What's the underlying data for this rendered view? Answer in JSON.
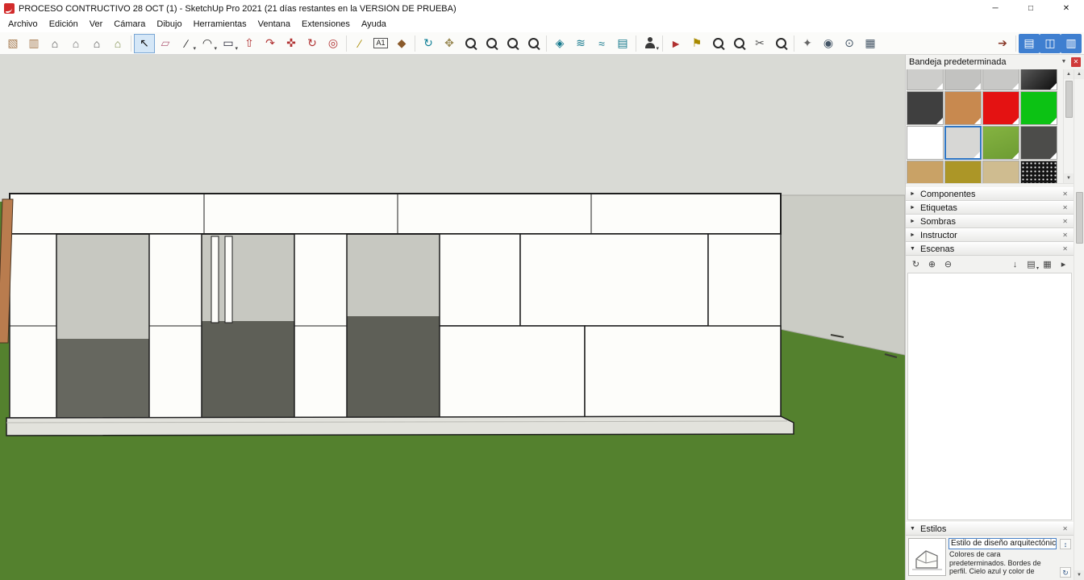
{
  "window": {
    "title": "PROCESO CONTRUCTIVO 28 OCT (1) - SketchUp Pro 2021 (21 días restantes en la VERSIÓN DE PRUEBA)",
    "controls": {
      "minimize": "─",
      "maximize": "□",
      "close": "✕"
    }
  },
  "menu": {
    "items": [
      {
        "name": "menu-archivo",
        "label": "Archivo"
      },
      {
        "name": "menu-edicion",
        "label": "Edición"
      },
      {
        "name": "menu-ver",
        "label": "Ver"
      },
      {
        "name": "menu-camara",
        "label": "Cámara"
      },
      {
        "name": "menu-dibujo",
        "label": "Dibujo"
      },
      {
        "name": "menu-herramientas",
        "label": "Herramientas"
      },
      {
        "name": "menu-ventana",
        "label": "Ventana"
      },
      {
        "name": "menu-extensiones",
        "label": "Extensiones"
      },
      {
        "name": "menu-ayuda",
        "label": "Ayuda"
      }
    ]
  },
  "toolbar": {
    "items": [
      {
        "name": "paste-box-icon",
        "glyph": "▧",
        "gs": "color:#a5794e",
        "inter": "true"
      },
      {
        "name": "copy-box-icon",
        "glyph": "▥",
        "gs": "color:#a5794e",
        "inter": "true"
      },
      {
        "name": "home-model-icon",
        "glyph": "⌂",
        "gs": "color:#4a4a4a",
        "inter": "true"
      },
      {
        "name": "home-stack-icon",
        "glyph": "⌂",
        "gs": "color:#6b6b6b",
        "inter": "true"
      },
      {
        "name": "home-alt-icon",
        "glyph": "⌂",
        "gs": "color:#4a4a4a",
        "inter": "true"
      },
      {
        "name": "home-plan-icon",
        "glyph": "⌂",
        "gs": "color:#7c8b49",
        "inter": "true"
      },
      {
        "name": "separator",
        "kind": "sep",
        "inter": "false"
      },
      {
        "name": "select-tool",
        "glyph": "↖",
        "gs": "color:#111",
        "sel": "true",
        "inter": "true"
      },
      {
        "name": "eraser-tool",
        "glyph": "▱",
        "gs": "color:#b2607a",
        "inter": "true"
      },
      {
        "name": "line-tool",
        "glyph": "∕",
        "gs": "color:#222",
        "dd": "▾",
        "inter": "true"
      },
      {
        "name": "arc-tool",
        "glyph": "◠",
        "gs": "color:#222",
        "dd": "▾",
        "inter": "true"
      },
      {
        "name": "rectangle-tool",
        "glyph": "▭",
        "gs": "color:#223",
        "dd": "▾",
        "inter": "true"
      },
      {
        "name": "pushpull-tool",
        "glyph": "⇧",
        "gs": "color:#b03030",
        "inter": "true"
      },
      {
        "name": "followme-tool",
        "glyph": "↷",
        "gs": "color:#b03030",
        "inter": "true"
      },
      {
        "name": "move-tool",
        "glyph": "✜",
        "gs": "color:#b03030",
        "inter": "true"
      },
      {
        "name": "rotate-tool",
        "glyph": "↻",
        "gs": "color:#b03030",
        "inter": "true"
      },
      {
        "name": "offset-tool",
        "glyph": "◎",
        "gs": "color:#b03030",
        "inter": "true"
      },
      {
        "name": "separator",
        "kind": "sep",
        "inter": "false"
      },
      {
        "name": "tape-measure-tool",
        "glyph": "∕",
        "gs": "color:#a88a00",
        "inter": "true"
      },
      {
        "name": "text-tool",
        "glyph": "A1",
        "kind": "text",
        "gs": "color:#222",
        "inter": "true"
      },
      {
        "name": "paint-bucket-tool",
        "glyph": "◆",
        "gs": "color:#8a5a2a",
        "inter": "true"
      },
      {
        "name": "separator",
        "kind": "sep",
        "inter": "false"
      },
      {
        "name": "orbit-tool",
        "glyph": "↻",
        "gs": "color:#0e7f96",
        "inter": "true"
      },
      {
        "name": "pan-tool",
        "glyph": "✥",
        "gs": "color:#9a8a55",
        "inter": "true"
      },
      {
        "name": "zoom-tool",
        "kind": "mag",
        "inter": "true"
      },
      {
        "name": "zoom-window-tool",
        "kind": "mag",
        "inter": "true"
      },
      {
        "name": "zoom-extents-tool",
        "kind": "mag",
        "inter": "true"
      },
      {
        "name": "previous-view-tool",
        "kind": "mag",
        "inter": "true"
      },
      {
        "name": "separator",
        "kind": "sep",
        "inter": "false"
      },
      {
        "name": "section-plane-tool",
        "glyph": "◈",
        "gs": "color:#14788c",
        "inter": "true"
      },
      {
        "name": "section-display-toggle",
        "glyph": "≋",
        "gs": "color:#14788c",
        "inter": "true"
      },
      {
        "name": "section-cuts-toggle",
        "glyph": "≈",
        "gs": "color:#14788c",
        "inter": "true"
      },
      {
        "name": "section-fill-toggle",
        "glyph": "▤",
        "gs": "color:#14788c",
        "inter": "true"
      },
      {
        "name": "separator",
        "kind": "sep",
        "inter": "false"
      },
      {
        "name": "camera-person-tool",
        "kind": "person",
        "dd": "▾",
        "inter": "true"
      },
      {
        "name": "separator",
        "kind": "sep",
        "inter": "false"
      },
      {
        "name": "walk-tool",
        "glyph": "►",
        "gs": "color:#b03030",
        "inter": "true"
      },
      {
        "name": "position-camera-tool",
        "glyph": "⚑",
        "gs": "color:#a88a00",
        "inter": "true"
      },
      {
        "name": "zoom-photo-tool",
        "kind": "mag",
        "inter": "true"
      },
      {
        "name": "zoom-selection-tool",
        "kind": "mag",
        "inter": "true"
      },
      {
        "name": "scissors-tool",
        "glyph": "✂",
        "gs": "color:#555",
        "inter": "true"
      },
      {
        "name": "inspect-tool",
        "kind": "mag",
        "inter": "true"
      },
      {
        "name": "separator",
        "kind": "sep",
        "inter": "false"
      },
      {
        "name": "spray-tool-icon",
        "glyph": "✦",
        "gs": "color:#666",
        "inter": "true"
      },
      {
        "name": "look-around-tool",
        "glyph": "◉",
        "gs": "color:#456",
        "inter": "true"
      },
      {
        "name": "binoculars-icon",
        "glyph": "⊙",
        "gs": "color:#456",
        "inter": "true"
      },
      {
        "name": "animation-icon",
        "glyph": "▦",
        "gs": "color:#456",
        "inter": "true"
      },
      {
        "name": "spacer",
        "kind": "spacer",
        "inter": "false"
      },
      {
        "name": "send-to-layout-icon",
        "glyph": "➔",
        "gs": "color:#8a3a2a",
        "inter": "true"
      },
      {
        "name": "separator",
        "kind": "sep",
        "inter": "false"
      },
      {
        "name": "panel-toggle-1-icon",
        "glyph": "▤",
        "kind": "active",
        "inter": "true"
      },
      {
        "name": "panel-toggle-2-icon",
        "glyph": "◫",
        "kind": "active",
        "inter": "true"
      },
      {
        "name": "panel-toggle-3-icon",
        "glyph": "▥",
        "kind": "active",
        "inter": "true"
      }
    ]
  },
  "viewport": {
    "colors": {
      "sky": "#d9dad5",
      "ground": "#54812e",
      "side_plane": "#cbccc5",
      "wall": "#fdfdfa",
      "interior_upper": "#c7c8c1",
      "interior_lower": "#66675f",
      "interior_dark": "#5e5f57",
      "slab": "#e2e2dc",
      "column": "#b97c4e",
      "edge": "#1e1e1e"
    }
  },
  "tray": {
    "title": "Bandeja predeterminada",
    "pin": "▼",
    "close": "✕",
    "scroll_up": "▲",
    "scroll_down": "▼",
    "materials": {
      "swatches": [
        {
          "name": "material-light-gray-1",
          "style": "background:#cdcdcb",
          "inter": "true"
        },
        {
          "name": "material-gray-2",
          "style": "background:#c2c2c0",
          "inter": "true"
        },
        {
          "name": "material-gray-3",
          "style": "background:#c8c8c6",
          "inter": "true"
        },
        {
          "name": "material-black-gradient",
          "style": "background:linear-gradient(135deg,#6a6a6a,#0d0d0d)",
          "inter": "true"
        },
        {
          "name": "material-charcoal",
          "style": "background:#3f3f3f",
          "inter": "true"
        },
        {
          "name": "material-orange-texture",
          "style": "background:#c8894f",
          "inter": "true"
        },
        {
          "name": "material-red",
          "style": "background:#e41212",
          "inter": "true"
        },
        {
          "name": "material-green",
          "style": "background:#0cc214",
          "inter": "true"
        },
        {
          "name": "material-white",
          "style": "background:#ffffff",
          "inter": "true"
        },
        {
          "name": "material-default-light-gray",
          "style": "background:#d7d7d5",
          "selected": "true",
          "inter": "true"
        },
        {
          "name": "material-grass",
          "style": "background:linear-gradient(160deg,#85b341,#6d9c33)",
          "inter": "true"
        },
        {
          "name": "material-asphalt",
          "style": "background:#4c4c4a",
          "inter": "true"
        },
        {
          "name": "material-wood-tan",
          "style": "background:#c9a266",
          "inter": "true"
        },
        {
          "name": "material-olive",
          "style": "background:#ac9627",
          "inter": "true"
        },
        {
          "name": "material-beige",
          "style": "background:#cfbc90",
          "inter": "true"
        },
        {
          "name": "material-black-dots",
          "style": "background:radial-gradient(#f5f5f5 1px,#141414 1.2px);background-size:5px 5px",
          "inter": "true"
        }
      ]
    },
    "sections": [
      {
        "name": "section-componentes",
        "label": "Componentes",
        "arrow": "►",
        "close": "✕"
      },
      {
        "name": "section-etiquetas",
        "label": "Etiquetas",
        "arrow": "►",
        "close": "✕"
      },
      {
        "name": "section-sombras",
        "label": "Sombras",
        "arrow": "►",
        "close": "✕"
      },
      {
        "name": "section-instructor",
        "label": "Instructor",
        "arrow": "►",
        "close": "✕"
      }
    ],
    "scenes": {
      "label": "Escenas",
      "arrow": "▼",
      "close": "✕",
      "buttons": [
        {
          "name": "update-scene-button",
          "glyph": "↻",
          "inter": "true"
        },
        {
          "name": "add-scene-button",
          "glyph": "⊕",
          "inter": "true"
        },
        {
          "name": "remove-scene-button",
          "glyph": "⊖",
          "inter": "true"
        },
        {
          "name": "spacer",
          "kind": "spacer",
          "inter": "false"
        },
        {
          "name": "move-scene-down-button",
          "glyph": "↓",
          "inter": "true"
        },
        {
          "name": "view-options-button",
          "glyph": "▤",
          "dd": "▾",
          "inter": "true"
        },
        {
          "name": "show-details-button",
          "glyph": "▦",
          "inter": "true"
        },
        {
          "name": "scene-menu-button",
          "glyph": "▸",
          "inter": "true"
        }
      ]
    },
    "styles": {
      "label": "Estilos",
      "arrow": "▼",
      "close": "✕",
      "style_name": "Estilo de diseño arquitectónico",
      "style_description": "Colores de cara predeterminados. Bordes de perfil. Cielo azul y color de",
      "inmodel_icon": "↕",
      "update_icon": "↻"
    }
  }
}
